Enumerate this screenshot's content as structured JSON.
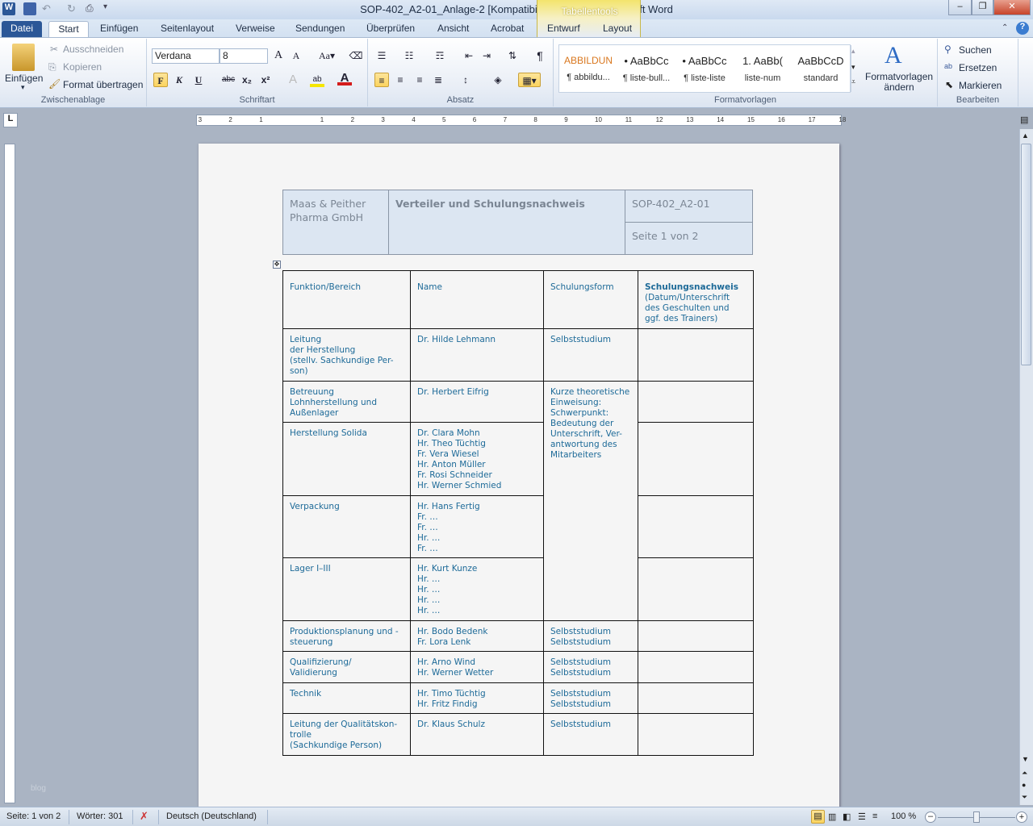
{
  "window": {
    "title": "SOP-402_A2-01_Anlage-2 [Kompatibilitätsmodus]  -  Microsoft Word",
    "context_tab_group": "Tabellentools"
  },
  "tabs": [
    "Datei",
    "Start",
    "Einfügen",
    "Seitenlayout",
    "Verweise",
    "Sendungen",
    "Überprüfen",
    "Ansicht",
    "Acrobat",
    "Entwurf",
    "Layout"
  ],
  "ribbon": {
    "clipboard": {
      "paste": "Einfügen",
      "cut": "Ausschneiden",
      "copy": "Kopieren",
      "format_painter": "Format übertragen",
      "label": "Zwischenablage"
    },
    "font": {
      "family": "Verdana",
      "size": "8",
      "bold": "F",
      "italic": "K",
      "underline": "U",
      "label": "Schriftart"
    },
    "paragraph": {
      "label": "Absatz"
    },
    "styles": {
      "items": [
        {
          "preview": "ABBILDUN",
          "name": "¶ abbildu..."
        },
        {
          "preview": "• AaBbCc",
          "name": "¶ liste-bull..."
        },
        {
          "preview": "• AaBbCc",
          "name": "¶ liste-liste"
        },
        {
          "preview": "1.  AaBb(",
          "name": "liste-num"
        },
        {
          "preview": "AaBbCcD",
          "name": "standard"
        }
      ],
      "change": "Formatvorlagen ändern",
      "label": "Formatvorlagen"
    },
    "editing": {
      "find": "Suchen",
      "replace": "Ersetzen",
      "select": "Markieren",
      "label": "Bearbeiten"
    }
  },
  "document": {
    "header": {
      "company": "Maas & Peither Pharma GmbH",
      "title": "Verteiler und Schulungsnachweis",
      "doc_id": "SOP-402_A2-01",
      "page": "Seite  1 von 2"
    },
    "table": {
      "columns": [
        "Funktion/Bereich",
        "Name",
        "Schulungsform",
        "Schulungsnachweis"
      ],
      "col4_sub": "(Datum/Unterschrift\ndes Geschulten und\nggf. des Trainers)",
      "rows": [
        {
          "func": "Leitung\nder Herstellung\n(stellv. Sachkundige Per-\nson)",
          "names": "Dr. Hilde Lehmann",
          "form": "Selbststudium"
        },
        {
          "func": "Betreuung\nLohnherstellung und\nAußenlager",
          "names": "Dr. Herbert Eifrig",
          "form": "Kurze theoretische\nEinweisung:\nSchwerpunkt:\nBedeutung der\nUnterschrift, Ver-\nantwortung des\nMitarbeiters"
        },
        {
          "func": "Herstellung Solida",
          "names": "Dr. Clara Mohn\nHr. Theo Tüchtig\nFr. Vera Wiesel\nHr. Anton Müller\nFr. Rosi Schneider\nHr. Werner Schmied"
        },
        {
          "func": "Verpackung",
          "names": "Hr. Hans Fertig\nFr. …\nFr. …\nHr. …\nFr. …"
        },
        {
          "func": "Lager I–III",
          "names": "Hr. Kurt Kunze\nHr. …\nHr. …\nHr. …\nHr. …"
        },
        {
          "func": "Produktionsplanung und -\nsteuerung",
          "names": "Hr. Bodo Bedenk\nFr. Lora Lenk",
          "form": "Selbststudium\nSelbststudium"
        },
        {
          "func": "Qualifizierung/\nValidierung",
          "names": "Hr. Arno Wind\nHr. Werner Wetter",
          "form": "Selbststudium\nSelbststudium"
        },
        {
          "func": "Technik",
          "names": "Hr. Timo Tüchtig\nHr. Fritz Findig",
          "form": "Selbststudium\nSelbststudium"
        },
        {
          "func": "Leitung der Qualitätskon-\ntrolle\n(Sachkundige Person)",
          "names": "Dr. Klaus Schulz",
          "form": "Selbststudium"
        }
      ]
    }
  },
  "watermark": "blog",
  "status": {
    "page": "Seite: 1 von 2",
    "words": "Wörter: 301",
    "language": "Deutsch (Deutschland)",
    "zoom": "100 %",
    "zoom_level": 100
  }
}
